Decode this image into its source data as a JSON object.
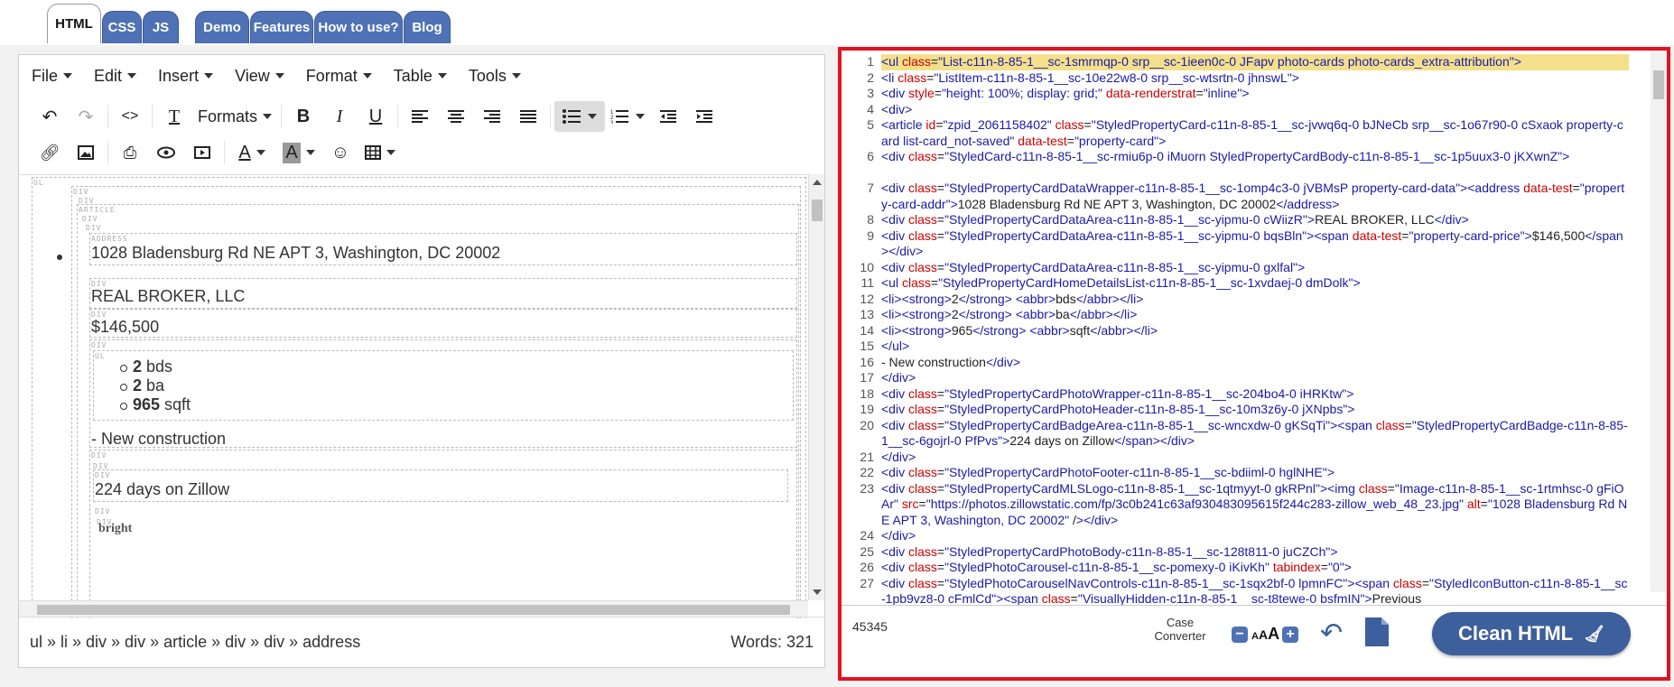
{
  "tabs": [
    "HTML",
    "CSS",
    "JS",
    "Demo",
    "Features",
    "How to use?",
    "Blog"
  ],
  "menubar": [
    "File",
    "Edit",
    "Insert",
    "View",
    "Format",
    "Table",
    "Tools"
  ],
  "toolbar": {
    "formats_label": "Formats"
  },
  "content": {
    "labels": {
      "ul": "UL",
      "div": "DIV",
      "article": "ARTICLE",
      "address": "ADDRESS"
    },
    "address": "1028 Bladensburg Rd NE APT 3, Washington, DC 20002",
    "broker": "REAL BROKER, LLC",
    "price": "$146,500",
    "details": [
      {
        "num": "2",
        "unit": " bds"
      },
      {
        "num": "2",
        "unit": " ba"
      },
      {
        "num": "965",
        "unit": " sqft"
      }
    ],
    "status": "- New construction",
    "days": "224 days on Zillow",
    "logo": "bright"
  },
  "statusbar": {
    "path": "ul » li » div » div » article » div » div » address",
    "words": "Words: 321"
  },
  "code": {
    "lines": [
      "<ul class=\"List-c11n-8-85-1__sc-1smrmqp-0 srp__sc-1ieen0c-0 JFapv photo-cards photo-cards_extra-attribution\">",
      "<li class=\"ListItem-c11n-8-85-1__sc-10e22w8-0 srp__sc-wtsrtn-0 jhnswL\">",
      "<div style=\"height: 100%; display: grid;\" data-renderstrat=\"inline\">",
      "<div>",
      "<article id=\"zpid_2061158402\" class=\"StyledPropertyCard-c11n-8-85-1__sc-jvwq6q-0 bJNeCb srp__sc-1o67r90-0 cSxaok property-card list-card_not-saved\" data-test=\"property-card\">",
      "<div class=\"StyledCard-c11n-8-85-1__sc-rmiu6p-0 iMuorn StyledPropertyCardBody-c11n-8-85-1__sc-1p5uux3-0 jKXwnZ\">",
      "<div class=\"StyledPropertyCardDataWrapper-c11n-8-85-1__sc-1omp4c3-0 jVBMsP property-card-data\"><address data-test=\"property-card-addr\">1028 Bladensburg Rd NE APT 3, Washington, DC 20002</address>",
      "<div class=\"StyledPropertyCardDataArea-c11n-8-85-1__sc-yipmu-0 cWiizR\">REAL BROKER, LLC</div>",
      "<div class=\"StyledPropertyCardDataArea-c11n-8-85-1__sc-yipmu-0 bqsBln\"><span data-test=\"property-card-price\">$146,500</span></div>",
      "<div class=\"StyledPropertyCardDataArea-c11n-8-85-1__sc-yipmu-0 gxlfal\">",
      "<ul class=\"StyledPropertyCardHomeDetailsList-c11n-8-85-1__sc-1xvdaej-0 dmDolk\">",
      "<li><strong>2</strong> <abbr>bds</abbr></li>",
      "<li><strong>2</strong> <abbr>ba</abbr></li>",
      "<li><strong>965</strong> <abbr>sqft</abbr></li>",
      "</ul>",
      "- New construction</div>",
      "</div>",
      "<div class=\"StyledPropertyCardPhotoWrapper-c11n-8-85-1__sc-204bo4-0 iHRKtw\">",
      "<div class=\"StyledPropertyCardPhotoHeader-c11n-8-85-1__sc-10m3z6y-0 jXNpbs\">",
      "<div class=\"StyledPropertyCardBadgeArea-c11n-8-85-1__sc-wncxdw-0 gKSqTi\"><span class=\"StyledPropertyCardBadge-c11n-8-85-1__sc-6gojrl-0 PfPvs\">224 days on Zillow</span></div>",
      "</div>",
      "<div class=\"StyledPropertyCardPhotoFooter-c11n-8-85-1__sc-bdiiml-0 hglNHE\">",
      "<div class=\"StyledPropertyCardMLSLogo-c11n-8-85-1__sc-1qtmyyt-0 gkRPnl\"><img class=\"Image-c11n-8-85-1__sc-1rtmhsc-0 gFiOAr\" src=\"https://photos.zillowstatic.com/fp/3c0b241c63af930483095615f244c283-zillow_web_48_23.jpg\" alt=\"1028 Bladensburg Rd NE APT 3, Washington, DC 20002\" /></div>",
      "</div>",
      "<div class=\"StyledPropertyCardPhotoBody-c11n-8-85-1__sc-128t811-0 juCZCh\">",
      "<div class=\"StyledPhotoCarousel-c11n-8-85-1__sc-pomexy-0 iKivKh\" tabindex=\"0\">",
      "<div class=\"StyledPhotoCarouselNavControls-c11n-8-85-1__sc-1sqx2bf-0 lpmnFC\"><span class=\"StyledIconButton-c11n-8-85-1__sc-1pb9vz8-0 cFmlCd\"><span class=\"VisuallyHidden-c11n-8-85-1__sc-t8tewe-0 bsfmIN\">Previous"
    ]
  },
  "bottom": {
    "char_count": "45345",
    "case_converter": "Case Converter",
    "font_sizes": "AAA",
    "clean_label": "Clean HTML"
  },
  "colors": {
    "accent": "#4e72b5",
    "highlight_border": "#e0141e",
    "clean_button": "#3d5f9c"
  }
}
